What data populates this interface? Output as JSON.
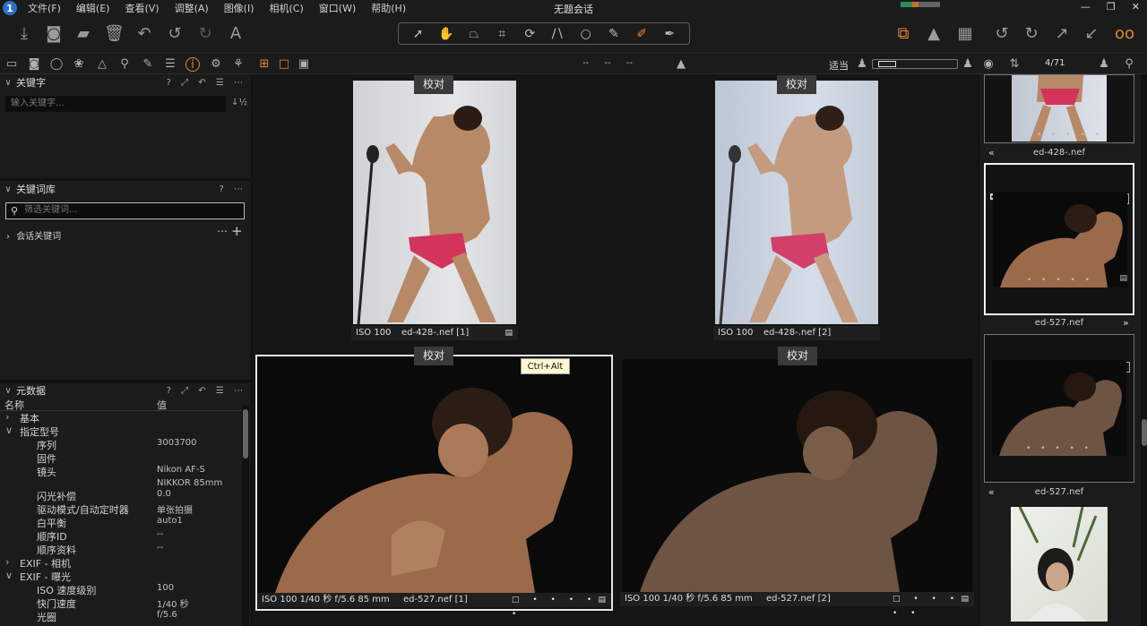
{
  "app": {
    "title": "无题会话"
  },
  "menu": [
    "文件(F)",
    "编辑(E)",
    "查看(V)",
    "调整(A)",
    "图像(I)",
    "相机(C)",
    "窗口(W)",
    "帮助(H)"
  ],
  "toolbar": {
    "left_icons": [
      "import-icon",
      "camera-icon",
      "export-icon",
      "trash-icon",
      "undo-all-icon",
      "undo-icon",
      "redo-icon",
      "text-icon"
    ],
    "cursor_tools": [
      "select-icon",
      "pan-icon",
      "keystone-icon",
      "crop-icon",
      "rotate-icon",
      "straighten-icon",
      "spot-icon",
      "brush-icon",
      "eraser-icon",
      "picker-icon"
    ],
    "right_icons": [
      "stack-icon",
      "warning-icon",
      "grid-icon",
      "rotate-left-icon",
      "rotate-right-icon",
      "expand-icon",
      "collapse-icon",
      "glasses-icon"
    ]
  },
  "viewbar": {
    "exposure_readout": "-- -- --",
    "fit_label": "适当",
    "counter": "4/71"
  },
  "left": {
    "keyword": {
      "title": "关键字",
      "placeholder": "输入关键字..."
    },
    "library": {
      "title": "关键词库",
      "placeholder": "筛选关键词...",
      "session": "会话关键词"
    },
    "metadata": {
      "title": "元数据",
      "col_name": "名称",
      "col_value": "值",
      "rows": [
        {
          "name": "基本",
          "value": "",
          "group": true
        },
        {
          "name": "指定型号",
          "value": "",
          "group": true
        },
        {
          "name": "序列",
          "value": "3003700"
        },
        {
          "name": "固件",
          "value": ""
        },
        {
          "name": "镜头",
          "value": "Nikon AF-S"
        },
        {
          "name": "",
          "value": "NIKKOR 85mm"
        },
        {
          "name": "闪光补偿",
          "value": "0.0"
        },
        {
          "name": "驱动模式/自动定时器",
          "value": "单张拍摄"
        },
        {
          "name": "白平衡",
          "value": "auto1"
        },
        {
          "name": "顺序ID",
          "value": "--"
        },
        {
          "name": "顺序资料",
          "value": "--"
        },
        {
          "name": "EXIF - 相机",
          "value": "",
          "group": true
        },
        {
          "name": "EXIF - 曝光",
          "value": "",
          "group": true
        },
        {
          "name": "ISO 速度级别",
          "value": "100"
        },
        {
          "name": "快门速度",
          "value": "1/40 秒"
        },
        {
          "name": "光圈",
          "value": "f/5.6"
        }
      ]
    }
  },
  "viewer": {
    "proof_label": "校对",
    "tooltip": "Ctrl+Alt",
    "tiles": [
      {
        "iso": "ISO 100",
        "file": "ed-428-.nef [1]"
      },
      {
        "iso": "ISO 100",
        "file": "ed-428-.nef [2]"
      },
      {
        "iso": "ISO 100 1/40 秒 f/5.6 85 mm",
        "file": "ed-527.nef [1]"
      },
      {
        "iso": "ISO 100 1/40 秒 f/5.6 85 mm",
        "file": "ed-527.nef [2]"
      }
    ]
  },
  "browser": {
    "items": [
      {
        "label": "ed-428-.nef"
      },
      {
        "label": "ed-527.nef",
        "badge": "1"
      },
      {
        "label": "ed-527.nef",
        "badge": "2"
      }
    ]
  }
}
